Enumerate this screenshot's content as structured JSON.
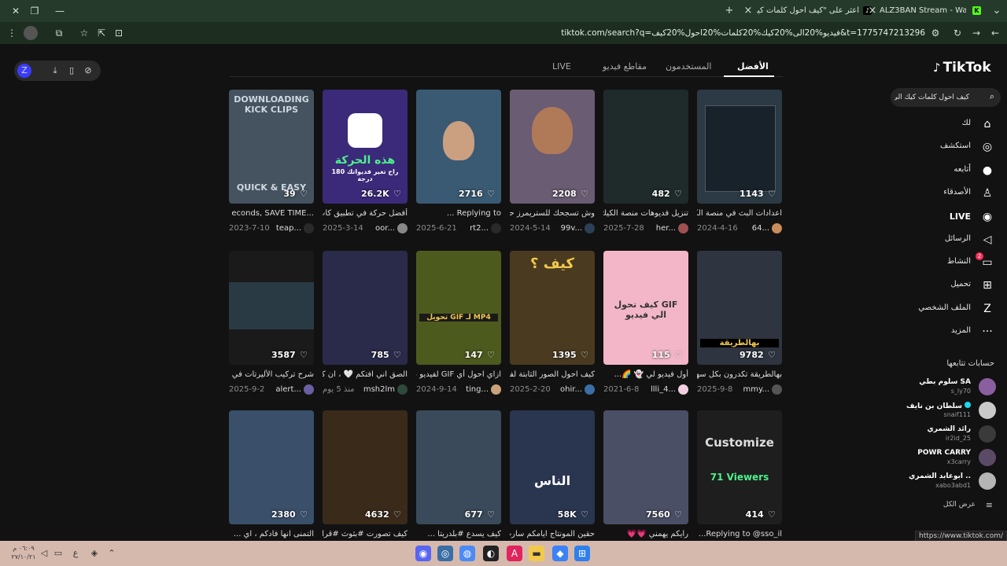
{
  "browser": {
    "tabs": [
      {
        "title": "اعثر على \"كيف احول كلمات كيك ا",
        "close": "×"
      },
      {
        "title": "ALZ3BAN Stream - Watch Live on",
        "close": "×"
      }
    ],
    "new_tab": "+",
    "url": "tiktok.com/search?q=فيديو%20الى%20كيك%20كلمات%20احول%20كيف&t=1775747213296",
    "status_url": "https://www.tiktok.com/"
  },
  "tiktok": {
    "logo": "TikTok",
    "search_value": "كيف احول كلمات كيك الى فيديو",
    "tabs": [
      "الأفضل",
      "المستخدمون",
      "مقاطع فيديو",
      "LIVE"
    ],
    "sidebar": [
      {
        "label": "لك",
        "icon": "⌂"
      },
      {
        "label": "استكشف",
        "icon": "◎"
      },
      {
        "label": "أتابعه",
        "icon": "●"
      },
      {
        "label": "الأصدقاء",
        "icon": "♙"
      },
      {
        "label": "LIVE",
        "icon": "◉"
      },
      {
        "label": "الرسائل",
        "icon": "◁"
      },
      {
        "label": "النشاط",
        "icon": "▭"
      },
      {
        "label": "تحميل",
        "icon": "⊞"
      },
      {
        "label": "الملف الشخصي",
        "icon": "Z"
      },
      {
        "label": "المزيد",
        "icon": "···"
      }
    ],
    "inbox_badge": "2",
    "following_title": "حسابات تتابعها",
    "following": [
      {
        "name": "سلوم بطي SA",
        "handle": "s_ly70",
        "color": "#8a5fa0"
      },
      {
        "name": "سلطان بن نايف",
        "handle": "snaif111",
        "color": "#c9c9c9",
        "verified": true
      },
      {
        "name": "رائد الشمري",
        "handle": "ir2id_25",
        "color": "#3a3a3a"
      },
      {
        "name": "POWR CARRY",
        "handle": "x3carry",
        "color": "#5a4a66"
      },
      {
        "name": "ابوعابد الشمري ..",
        "handle": "xabo3abd1",
        "color": "#b5b5b5"
      }
    ],
    "see_all": "عرض الكل"
  },
  "videos": [
    {
      "views": "1143",
      "caption": "اعدادات البث في منصة الكيك...",
      "author": "64...",
      "date": "2024-4-16",
      "bg": "#2b3a44",
      "av": "#c98c5a"
    },
    {
      "views": "482",
      "caption": "تنزيل فديوهات منصة الكيك",
      "author": "her...",
      "date": "2025-7-28",
      "bg": "#1f2b2a",
      "av": "#a05050"
    },
    {
      "views": "2208",
      "caption": "وش تسجحك للستريمرز حـ",
      "author": "99v...",
      "date": "2024-5-14",
      "bg": "#6a5c72",
      "av": "#2b3f57"
    },
    {
      "views": "2716",
      "caption": "Replying to ...",
      "author": "rt2...",
      "date": "2025-6-21",
      "bg": "#3a5a73",
      "av": "#2a2a2a"
    },
    {
      "views": "26.2K",
      "caption": "أفضل حركة في تطبيق كاب ...",
      "author": "oor...",
      "date": "2025-3-14",
      "bg": "#3b2a7a",
      "av": "#888"
    },
    {
      "views": "39",
      "caption": "...econds, SAVE TIME",
      "author": "teap...",
      "date": "2023-7-10",
      "bg": "#455260",
      "av": "#2a2a2a"
    },
    {
      "views": "9782",
      "caption": "بهالطريقة تكدرون بكل سهولـ...",
      "author": "mmy...",
      "date": "2025-9-8",
      "bg": "#2e3440",
      "av": "#555"
    },
    {
      "views": "115",
      "caption": "أول فيديو لي 👻 🌈...",
      "author": "llli_4...",
      "date": "2021-6-8",
      "bg": "#f3b6c8",
      "av": "#f0d0e0"
    },
    {
      "views": "1395",
      "caption": "كيف احول الصور الثابتة لفيـ...",
      "author": "ohir...",
      "date": "2025-2-20",
      "bg": "#4a3b20",
      "av": "#3a6ea5"
    },
    {
      "views": "147",
      "caption": "ازاي احول أي GIF لفيديو 4...",
      "author": "ting...",
      "date": "2024-9-14",
      "bg": "#4d5a1e",
      "av": "#c9a27a"
    },
    {
      "views": "785",
      "caption": "الصق اني افتكم 🤍 ، ان كا...",
      "author": "msh2lm",
      "date": "منذ 5 يوم",
      "bg": "#2a2a4a",
      "av": "#2e4a3a"
    },
    {
      "views": "3587",
      "caption": "شرح تركيب الأليرتات في سـ...",
      "author": "alert...",
      "date": "2025-9-2",
      "bg": "#1a1a1a",
      "av": "#6a5fa0"
    },
    {
      "views": "414",
      "caption": "Replying to @sso_il...",
      "author": "",
      "date": "",
      "bg": "#1e1e1e",
      "av": "#333"
    },
    {
      "views": "7560",
      "caption": "رايكم يهمني 💗💗",
      "author": "",
      "date": "",
      "bg": "#4a4f66",
      "av": "#333"
    },
    {
      "views": "58K",
      "caption": "حقين المونتاج ايامكم سارت ...",
      "author": "",
      "date": "",
      "bg": "#2a3550",
      "av": "#333"
    },
    {
      "views": "677",
      "caption": "كيف يسدع #بلدريتا ...",
      "author": "",
      "date": "",
      "bg": "#3a4a5a",
      "av": "#333"
    },
    {
      "views": "4632",
      "caption": "كيف تصورت #بثوث #قرائد...",
      "author": "",
      "date": "",
      "bg": "#3a2a1a",
      "av": "#333"
    },
    {
      "views": "2380",
      "caption": "التمنى انها فادكم ، اي ...",
      "author": "",
      "date": "",
      "bg": "#3a4f6a",
      "av": "#333"
    }
  ],
  "thumb_texts": {
    "t2": "كيف ؟",
    "t3": "تحويل GIF لـ MP4",
    "t5": "DOWNLOADING KICK CLIPS",
    "t5b": "QUICK & EASY",
    "t4": "هذه الحركة",
    "t4b": "راح تغير فديواتك 180 درجة",
    "t7": "كيف تحول GIF الي فيديو",
    "t6": "بهالطريقة",
    "t14": "الناس",
    "t12": "Customize",
    "t12b": "71 Viewers"
  },
  "taskbar": {
    "time": "٠٦:٠٩ م",
    "date": "٢٧/١٠/٢١",
    "lang": "ع"
  }
}
